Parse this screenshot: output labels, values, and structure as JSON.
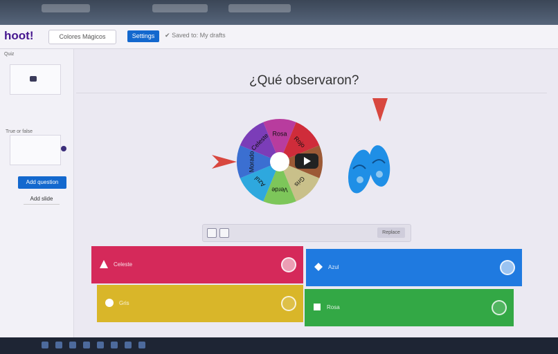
{
  "app": {
    "logo": "hoot!",
    "kahoot_title": "Colores Mágicos",
    "settings_label": "Settings",
    "saved_status": "Saved to: My drafts"
  },
  "sidebar": {
    "quiz_label": "Quiz",
    "true_false_label": "True or false",
    "add_question_label": "Add question",
    "add_slide_label": "Add slide"
  },
  "question": {
    "title": "¿Qué observaron?"
  },
  "wheel": {
    "segments": [
      "Rosa",
      "Rojo",
      "Café",
      "Gris",
      "Verde",
      "Azul",
      "Morado",
      "Celeste"
    ],
    "colors": [
      "#b83c9e",
      "#cf2c3a",
      "#9c5a36",
      "#c9c08a",
      "#7dc65a",
      "#2ea8de",
      "#3b6fd1",
      "#7b3db8"
    ]
  },
  "media": {
    "replace_label": "Replace"
  },
  "answers": [
    {
      "label": "Celeste",
      "shape": "triangle-icon",
      "color": "#d5295a",
      "correct": true
    },
    {
      "label": "Azul",
      "shape": "diamond-icon",
      "color": "#1f7ae0",
      "correct": true
    },
    {
      "label": "Gris",
      "shape": "circle-icon",
      "color": "#d9b629",
      "correct": false
    },
    {
      "label": "Rosa",
      "shape": "square-icon",
      "color": "#33a845",
      "correct": false
    }
  ]
}
